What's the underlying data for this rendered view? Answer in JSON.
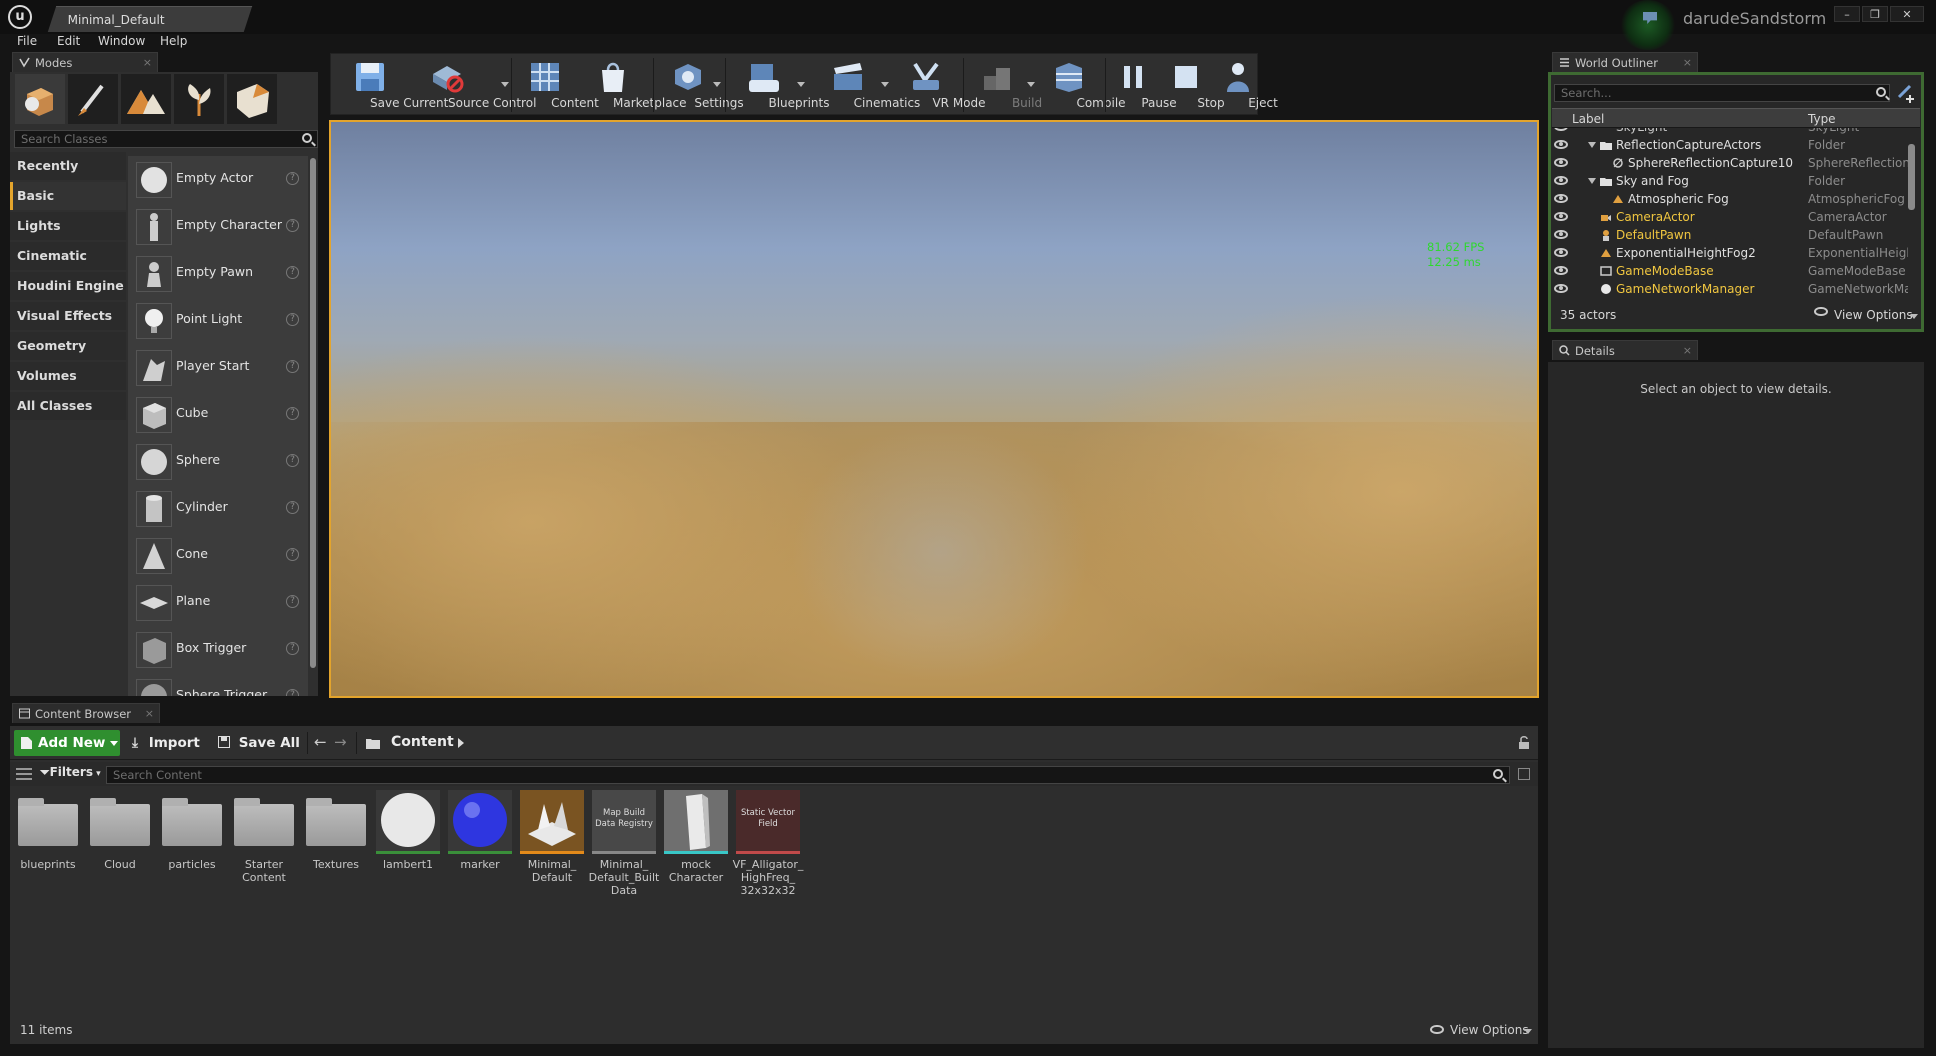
{
  "title_bar": {
    "doc_tab": "Minimal_Default",
    "user": "darudeSandstorm",
    "controls": [
      "–",
      "❐",
      "✕"
    ]
  },
  "menu": [
    "File",
    "Edit",
    "Window",
    "Help"
  ],
  "modes": {
    "tab": "Modes",
    "search_placeholder": "Search Classes",
    "mode_icons": [
      "place-mode-icon",
      "paint-mode-icon",
      "landscape-mode-icon",
      "foliage-mode-icon",
      "geometry-mode-icon"
    ],
    "categories": [
      "Recently Placed",
      "Basic",
      "Lights",
      "Cinematic",
      "Houdini Engine",
      "Visual Effects",
      "Geometry",
      "Volumes",
      "All Classes"
    ],
    "active_category": "Basic",
    "classes": [
      "Empty Actor",
      "Empty Character",
      "Empty Pawn",
      "Point Light",
      "Player Start",
      "Cube",
      "Sphere",
      "Cylinder",
      "Cone",
      "Plane",
      "Box Trigger",
      "Sphere Trigger"
    ]
  },
  "toolbar": {
    "buttons": [
      {
        "label": "Save Current",
        "icon": "save-icon"
      },
      {
        "label": "Source Control",
        "icon": "source-control-icon"
      },
      {
        "label": "Content",
        "icon": "content-icon"
      },
      {
        "label": "Marketplace",
        "icon": "marketplace-icon"
      },
      {
        "label": "Settings",
        "icon": "settings-icon"
      },
      {
        "label": "Blueprints",
        "icon": "blueprints-icon"
      },
      {
        "label": "Cinematics",
        "icon": "cinematics-icon"
      },
      {
        "label": "VR Mode",
        "icon": "vr-mode-icon"
      },
      {
        "label": "Build",
        "icon": "build-icon"
      },
      {
        "label": "Compile",
        "icon": "compile-icon"
      },
      {
        "label": "Pause",
        "icon": "pause-icon"
      },
      {
        "label": "Stop",
        "icon": "stop-icon"
      },
      {
        "label": "Eject",
        "icon": "eject-icon"
      }
    ]
  },
  "viewport": {
    "fps": "81.62 FPS",
    "ms": "12.25 ms"
  },
  "outliner": {
    "tab": "World Outliner",
    "search_placeholder": "Search...",
    "col_label": "Label",
    "col_type": "Type",
    "rows": [
      {
        "label": "SkyLight",
        "type": "SkyLight",
        "color": "#c8c8c8"
      },
      {
        "label": "ReflectionCaptureActors",
        "type": "Folder",
        "color": "#e0e0e0"
      },
      {
        "label": "SphereReflectionCapture10",
        "type": "SphereReflectionC",
        "color": "#e0e0e0"
      },
      {
        "label": "Sky and Fog",
        "type": "Folder",
        "color": "#e0e0e0"
      },
      {
        "label": "Atmospheric Fog",
        "type": "AtmosphericFog",
        "color": "#e0e0e0"
      },
      {
        "label": "CameraActor",
        "type": "CameraActor",
        "color": "#f0c640"
      },
      {
        "label": "DefaultPawn",
        "type": "DefaultPawn",
        "color": "#f0c640"
      },
      {
        "label": "ExponentialHeightFog2",
        "type": "ExponentialHeigh",
        "color": "#e0e0e0"
      },
      {
        "label": "GameModeBase",
        "type": "GameModeBase",
        "color": "#f0c640"
      },
      {
        "label": "GameNetworkManager",
        "type": "GameNetworkMar",
        "color": "#f0c640"
      }
    ],
    "count": "35 actors",
    "view_options": "View Options"
  },
  "details": {
    "tab": "Details",
    "empty_msg": "Select an object to view details."
  },
  "content_browser": {
    "tab": "Content Browser",
    "add_new": "Add New",
    "import": "Import",
    "save_all": "Save All",
    "path": "Content",
    "filters": "Filters",
    "search_placeholder": "Search Content",
    "assets": [
      {
        "label": "blueprints",
        "kind": "folder"
      },
      {
        "label": "Cloud",
        "kind": "folder"
      },
      {
        "label": "particles",
        "kind": "folder"
      },
      {
        "label": "Starter Content",
        "kind": "folder"
      },
      {
        "label": "Textures",
        "kind": "folder"
      },
      {
        "label": "lambert1",
        "kind": "material-white"
      },
      {
        "label": "marker",
        "kind": "material-blue"
      },
      {
        "label": "Minimal_ Default",
        "kind": "level"
      },
      {
        "label": "Minimal_ Default_Built Data",
        "kind": "registry",
        "thumb_text": "Map Build Data Registry"
      },
      {
        "label": "mock Character",
        "kind": "mesh"
      },
      {
        "label": "VF_Alligator_ HighFreq_ 32x32x32",
        "kind": "vector-field",
        "thumb_text": "Static Vector Field"
      }
    ],
    "count": "11 items",
    "view_options": "View Options"
  }
}
